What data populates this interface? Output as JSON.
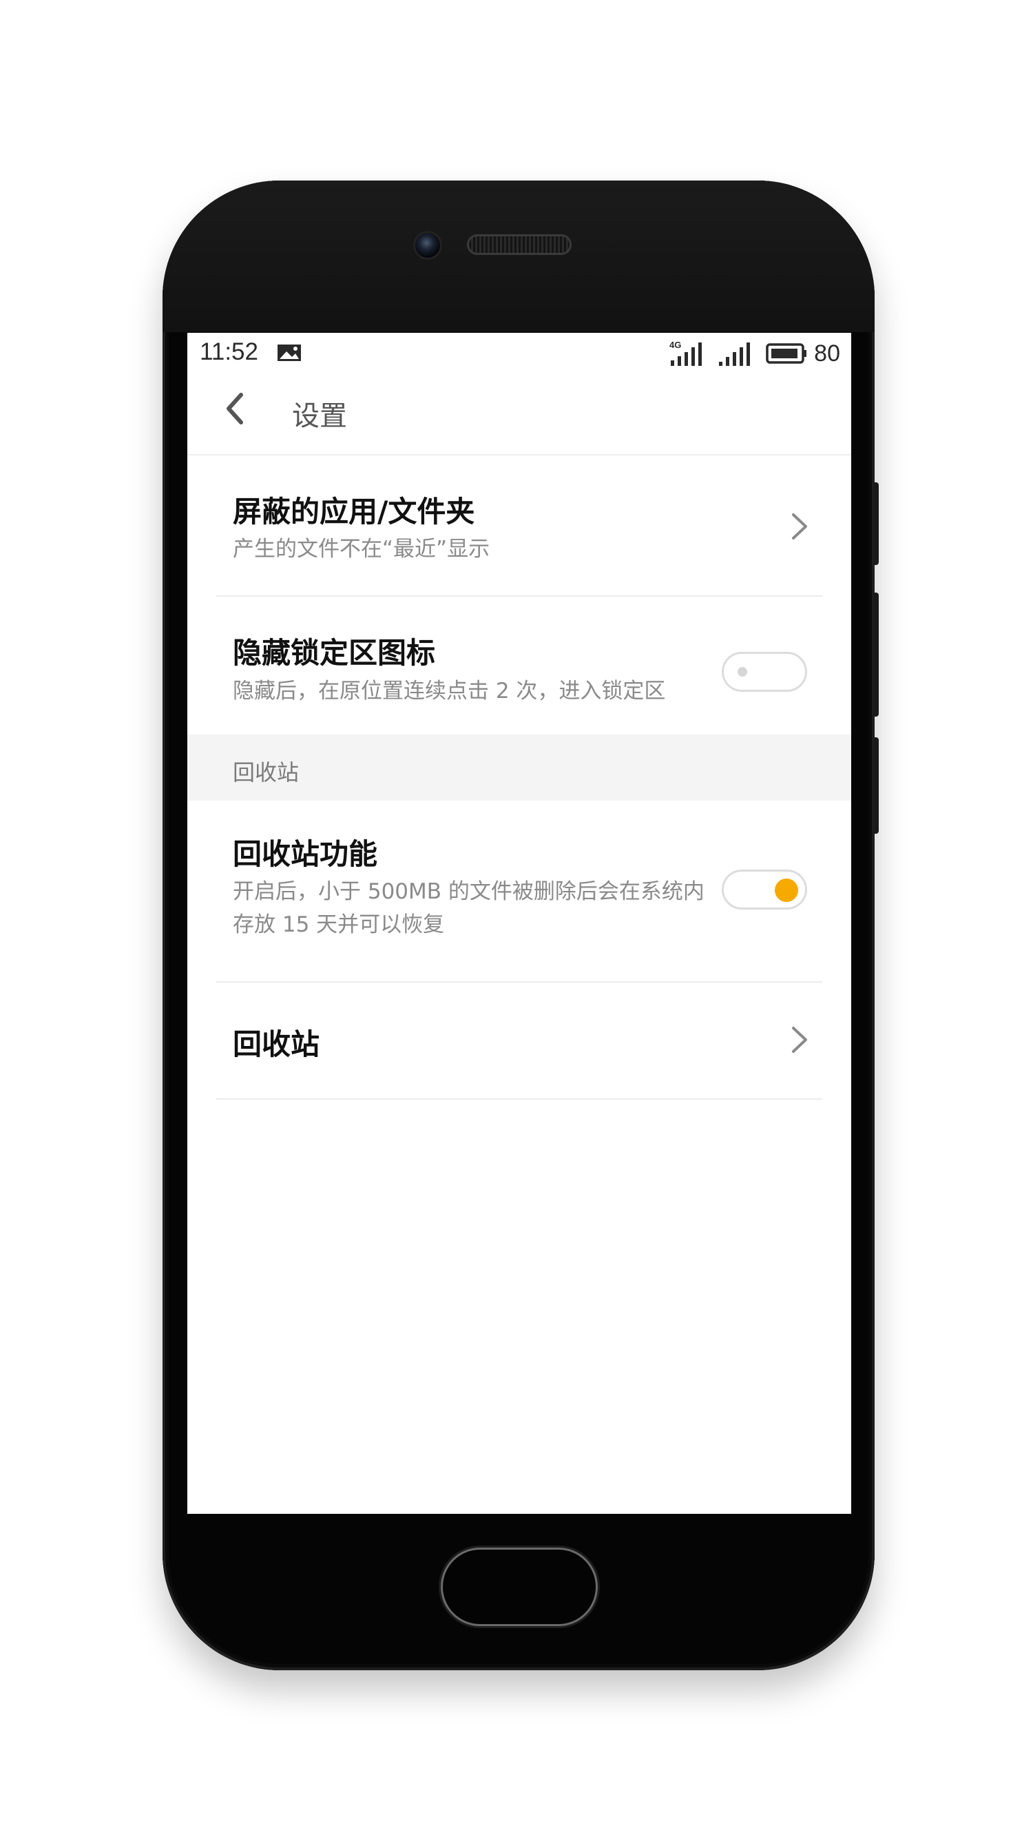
{
  "status_bar": {
    "time": "11:52",
    "network_label": "4G",
    "battery_level": "80",
    "icons": [
      "notification-image-icon",
      "signal-4g-icon",
      "signal-icon",
      "battery-icon"
    ]
  },
  "app_bar": {
    "title": "设置",
    "back_icon": "chevron-left-icon"
  },
  "settings": {
    "blocked": {
      "title": "屏蔽的应用/文件夹",
      "subtitle": "产生的文件不在“最近”显示"
    },
    "hide_lock": {
      "title": "隐藏锁定区图标",
      "subtitle": "隐藏后，在原位置连续点击 2 次，进入锁定区",
      "enabled": false
    },
    "recycle_section_label": "回收站",
    "recycle_feature": {
      "title": "回收站功能",
      "subtitle": "开启后，小于 500MB 的文件被删除后会在系统内存放 15 天并可以恢复",
      "enabled": true
    },
    "recycle_bin": {
      "title": "回收站"
    }
  },
  "colors": {
    "accent": "#F6AA00",
    "section_bg": "#f4f4f4",
    "title_text": "#111111",
    "subtitle_text": "#8a8a8a"
  }
}
